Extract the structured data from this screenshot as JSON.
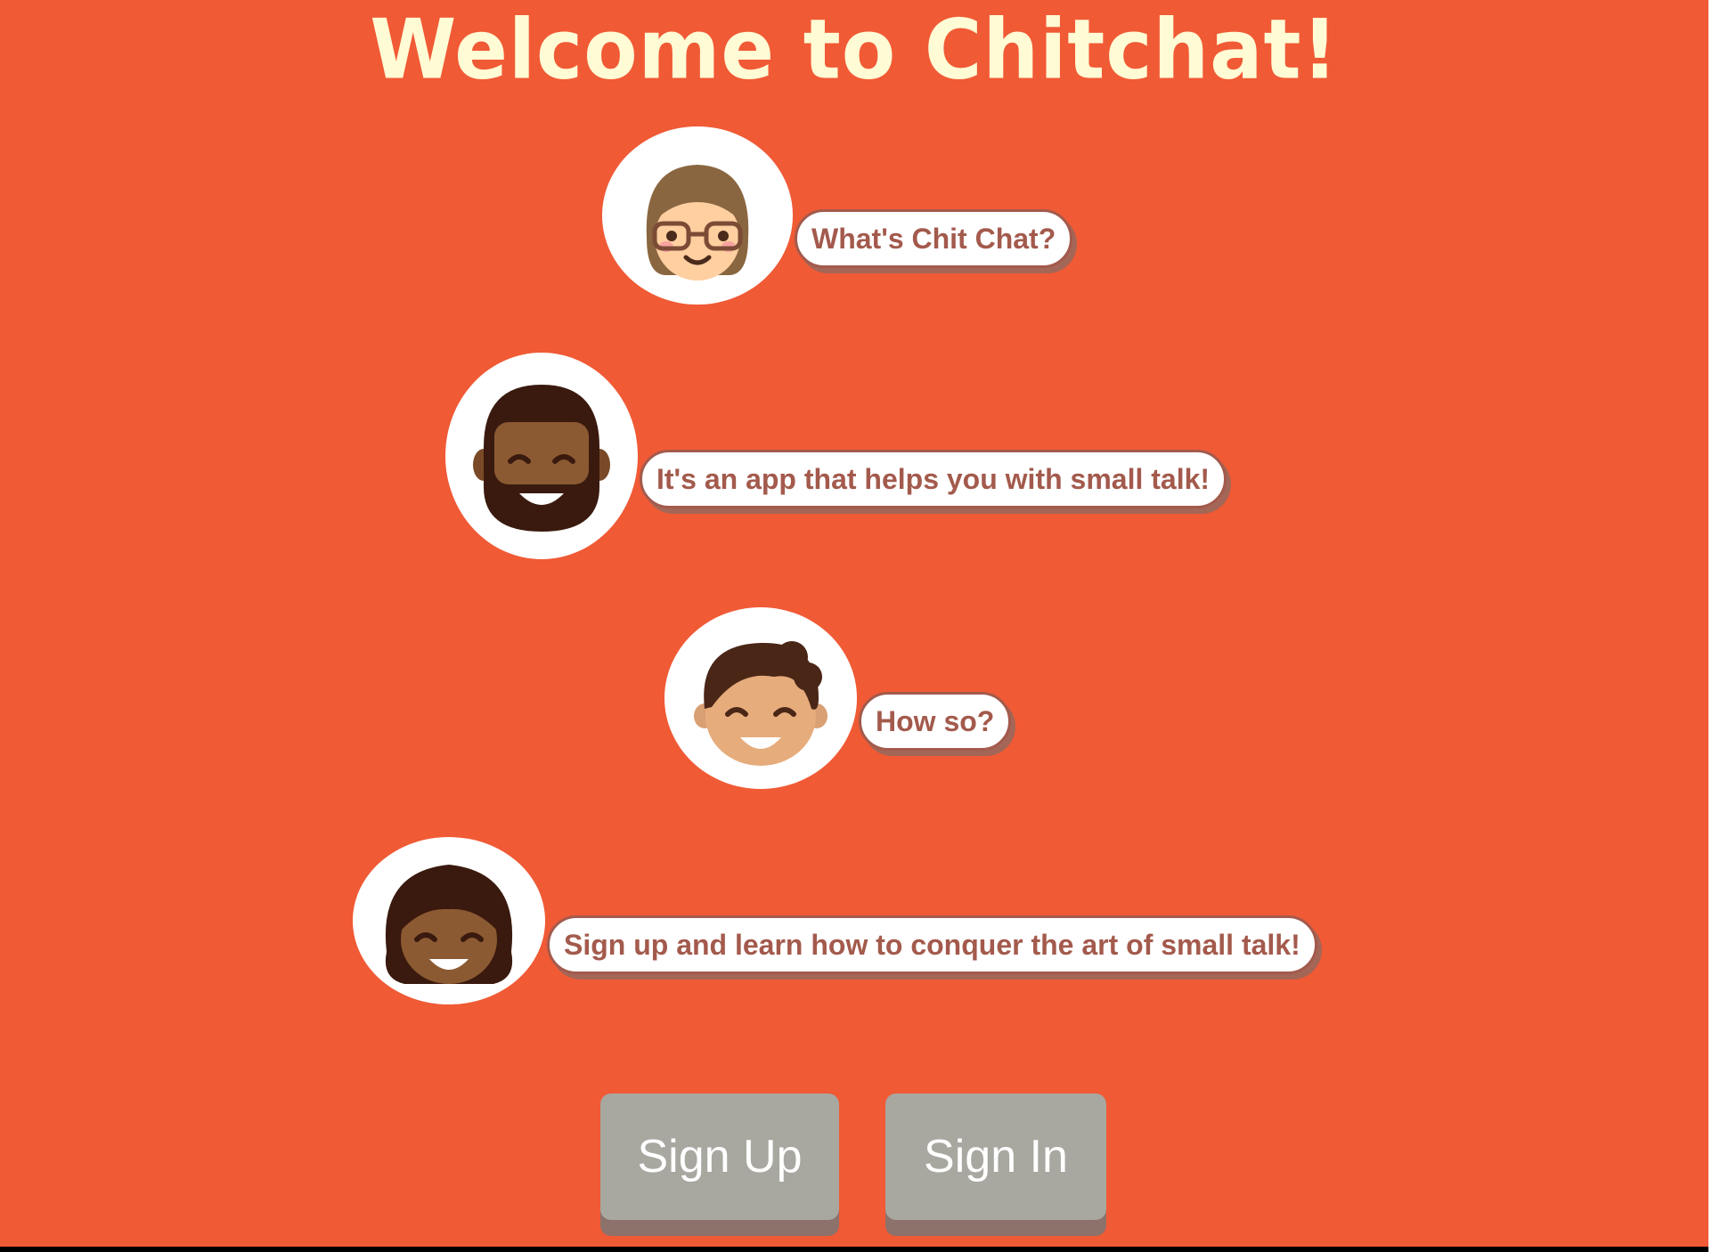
{
  "page": {
    "title": "Welcome to Chitchat!"
  },
  "conversation": [
    {
      "avatar": "woman-with-glasses-avatar",
      "message": "What's Chit Chat?"
    },
    {
      "avatar": "bearded-man-avatar",
      "message": "It's an app that helps you with small talk!"
    },
    {
      "avatar": "smiling-man-avatar",
      "message": "How so?"
    },
    {
      "avatar": "smiling-woman-avatar",
      "message": "Sign up and learn how to conquer the art of small talk!"
    }
  ],
  "actions": {
    "sign_up_label": "Sign Up",
    "sign_in_label": "Sign In"
  },
  "colors": {
    "background": "#F05A35",
    "title": "#FFFBD5",
    "bubble_text": "#A35A4C",
    "button": "#A8A7A0"
  }
}
